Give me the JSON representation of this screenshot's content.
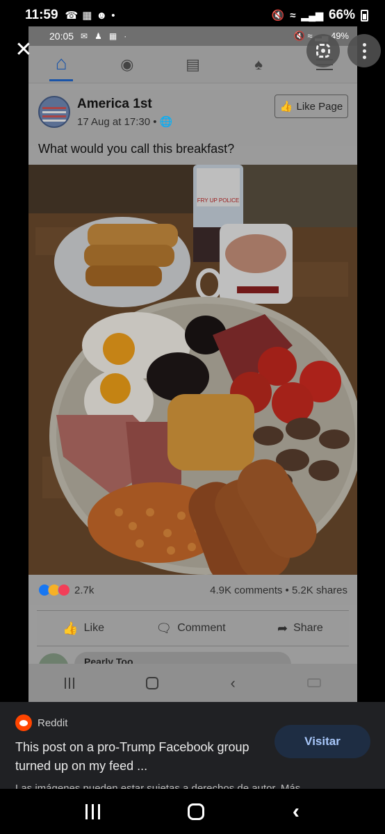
{
  "outer_status": {
    "time": "11:59",
    "battery": "66%"
  },
  "inner_status": {
    "time": "20:05",
    "battery": "49%"
  },
  "post": {
    "page_name": "America 1st",
    "timestamp": "17 Aug at 17:30 •",
    "like_page_label": "Like Page",
    "caption": "What would you call this breakfast?",
    "reaction_count": "2.7k",
    "stats": "4.9K comments • 5.2K shares",
    "actions": {
      "like": "Like",
      "comment": "Comment",
      "share": "Share"
    },
    "comment_peek": "Pearly Too"
  },
  "photo_label": "FRY UP POLICE",
  "card": {
    "source": "Reddit",
    "title": "This post on a pro-Trump Facebook group turned up on my feed ...",
    "visit_label": "Visitar",
    "footer": "Las imágenes pueden estar sujetas a derechos de autor. Más"
  },
  "colors": {
    "reddit": "#ff4500",
    "fb_blue": "#1a54a8",
    "visit_text": "#a8c7fa"
  }
}
